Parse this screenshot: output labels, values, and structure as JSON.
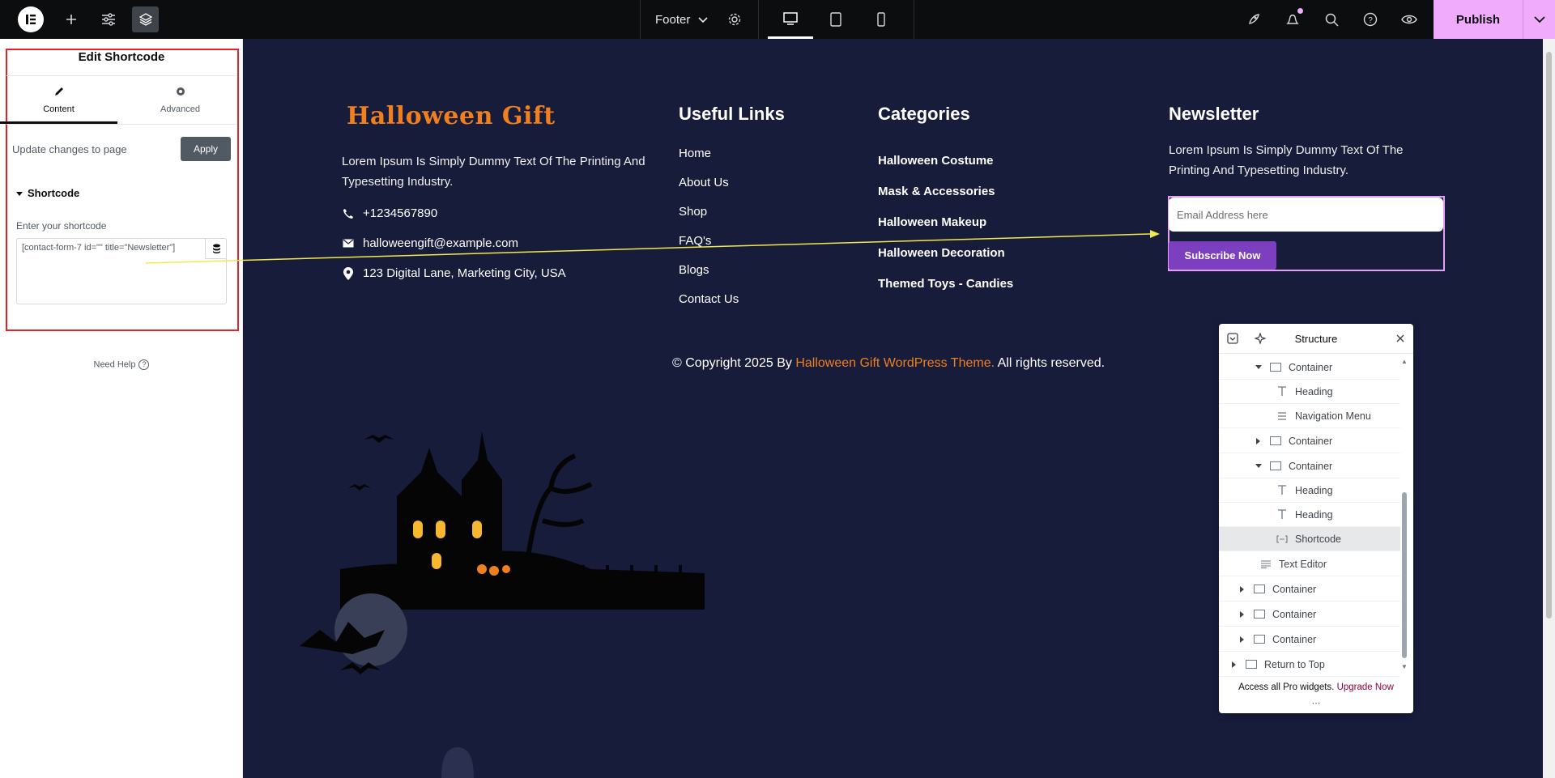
{
  "topbar": {
    "document_title": "Footer",
    "publish_label": "Publish"
  },
  "panel": {
    "title": "Edit Shortcode",
    "tabs": [
      {
        "label": "Content",
        "icon": "pencil-icon"
      },
      {
        "label": "Advanced",
        "icon": "gear-icon"
      }
    ],
    "update_text": "Update changes to page",
    "apply_label": "Apply",
    "section_title": "Shortcode",
    "field_label": "Enter your shortcode",
    "shortcode_value": "[contact-form-7 id=\"\" title=\"Newsletter\"]",
    "need_help": "Need Help"
  },
  "footer": {
    "brand": "Halloween Gift",
    "about_text": "Lorem Ipsum Is Simply Dummy Text Of The Printing And Typesetting Industry.",
    "phone": "+1234567890",
    "email": "halloweengift@example.com",
    "address": "123 Digital Lane, Marketing City, USA",
    "useful_links_heading": "Useful Links",
    "useful_links": [
      "Home",
      "About Us",
      "Shop",
      "FAQ's",
      "Blogs",
      "Contact Us"
    ],
    "categories_heading": "Categories",
    "categories": [
      "Halloween Costume",
      "Mask & Accessories",
      "Halloween Makeup",
      "Halloween Decoration",
      "Themed Toys - Candies"
    ],
    "newsletter_heading": "Newsletter",
    "newsletter_text": "Lorem Ipsum Is Simply Dummy Text Of The Printing And Typesetting Industry.",
    "email_placeholder": "Email Address here",
    "subscribe_label": "Subscribe Now",
    "copyright_prefix": "© Copyright 2025 By ",
    "copyright_link": "Halloween Gift WordPress Theme.",
    "copyright_suffix": " All rights reserved."
  },
  "structure": {
    "title": "Structure",
    "rows": [
      {
        "label": "Container",
        "type": "container",
        "expanded": true
      },
      {
        "label": "Heading",
        "type": "heading"
      },
      {
        "label": "Navigation Menu",
        "type": "menu"
      },
      {
        "label": "Container",
        "type": "container",
        "expanded": false
      },
      {
        "label": "Container",
        "type": "container",
        "expanded": true
      },
      {
        "label": "Heading",
        "type": "heading"
      },
      {
        "label": "Heading",
        "type": "heading"
      },
      {
        "label": "Shortcode",
        "type": "shortcode",
        "selected": true
      },
      {
        "label": "Text Editor",
        "type": "text"
      },
      {
        "label": "Container",
        "type": "container",
        "expanded": false
      },
      {
        "label": "Container",
        "type": "container",
        "expanded": false
      },
      {
        "label": "Container",
        "type": "container",
        "expanded": false
      },
      {
        "label": "Return to Top",
        "type": "container",
        "expanded": false
      }
    ],
    "footer_text": "Access all Pro widgets.",
    "upgrade_label": "Upgrade Now"
  },
  "colors": {
    "canvas_bg": "#171c3b",
    "brand_orange": "#f07f1f",
    "publish_pink": "#f0abfc",
    "subscribe_purple": "#7b3fbf",
    "highlight_red": "#e1242a"
  }
}
